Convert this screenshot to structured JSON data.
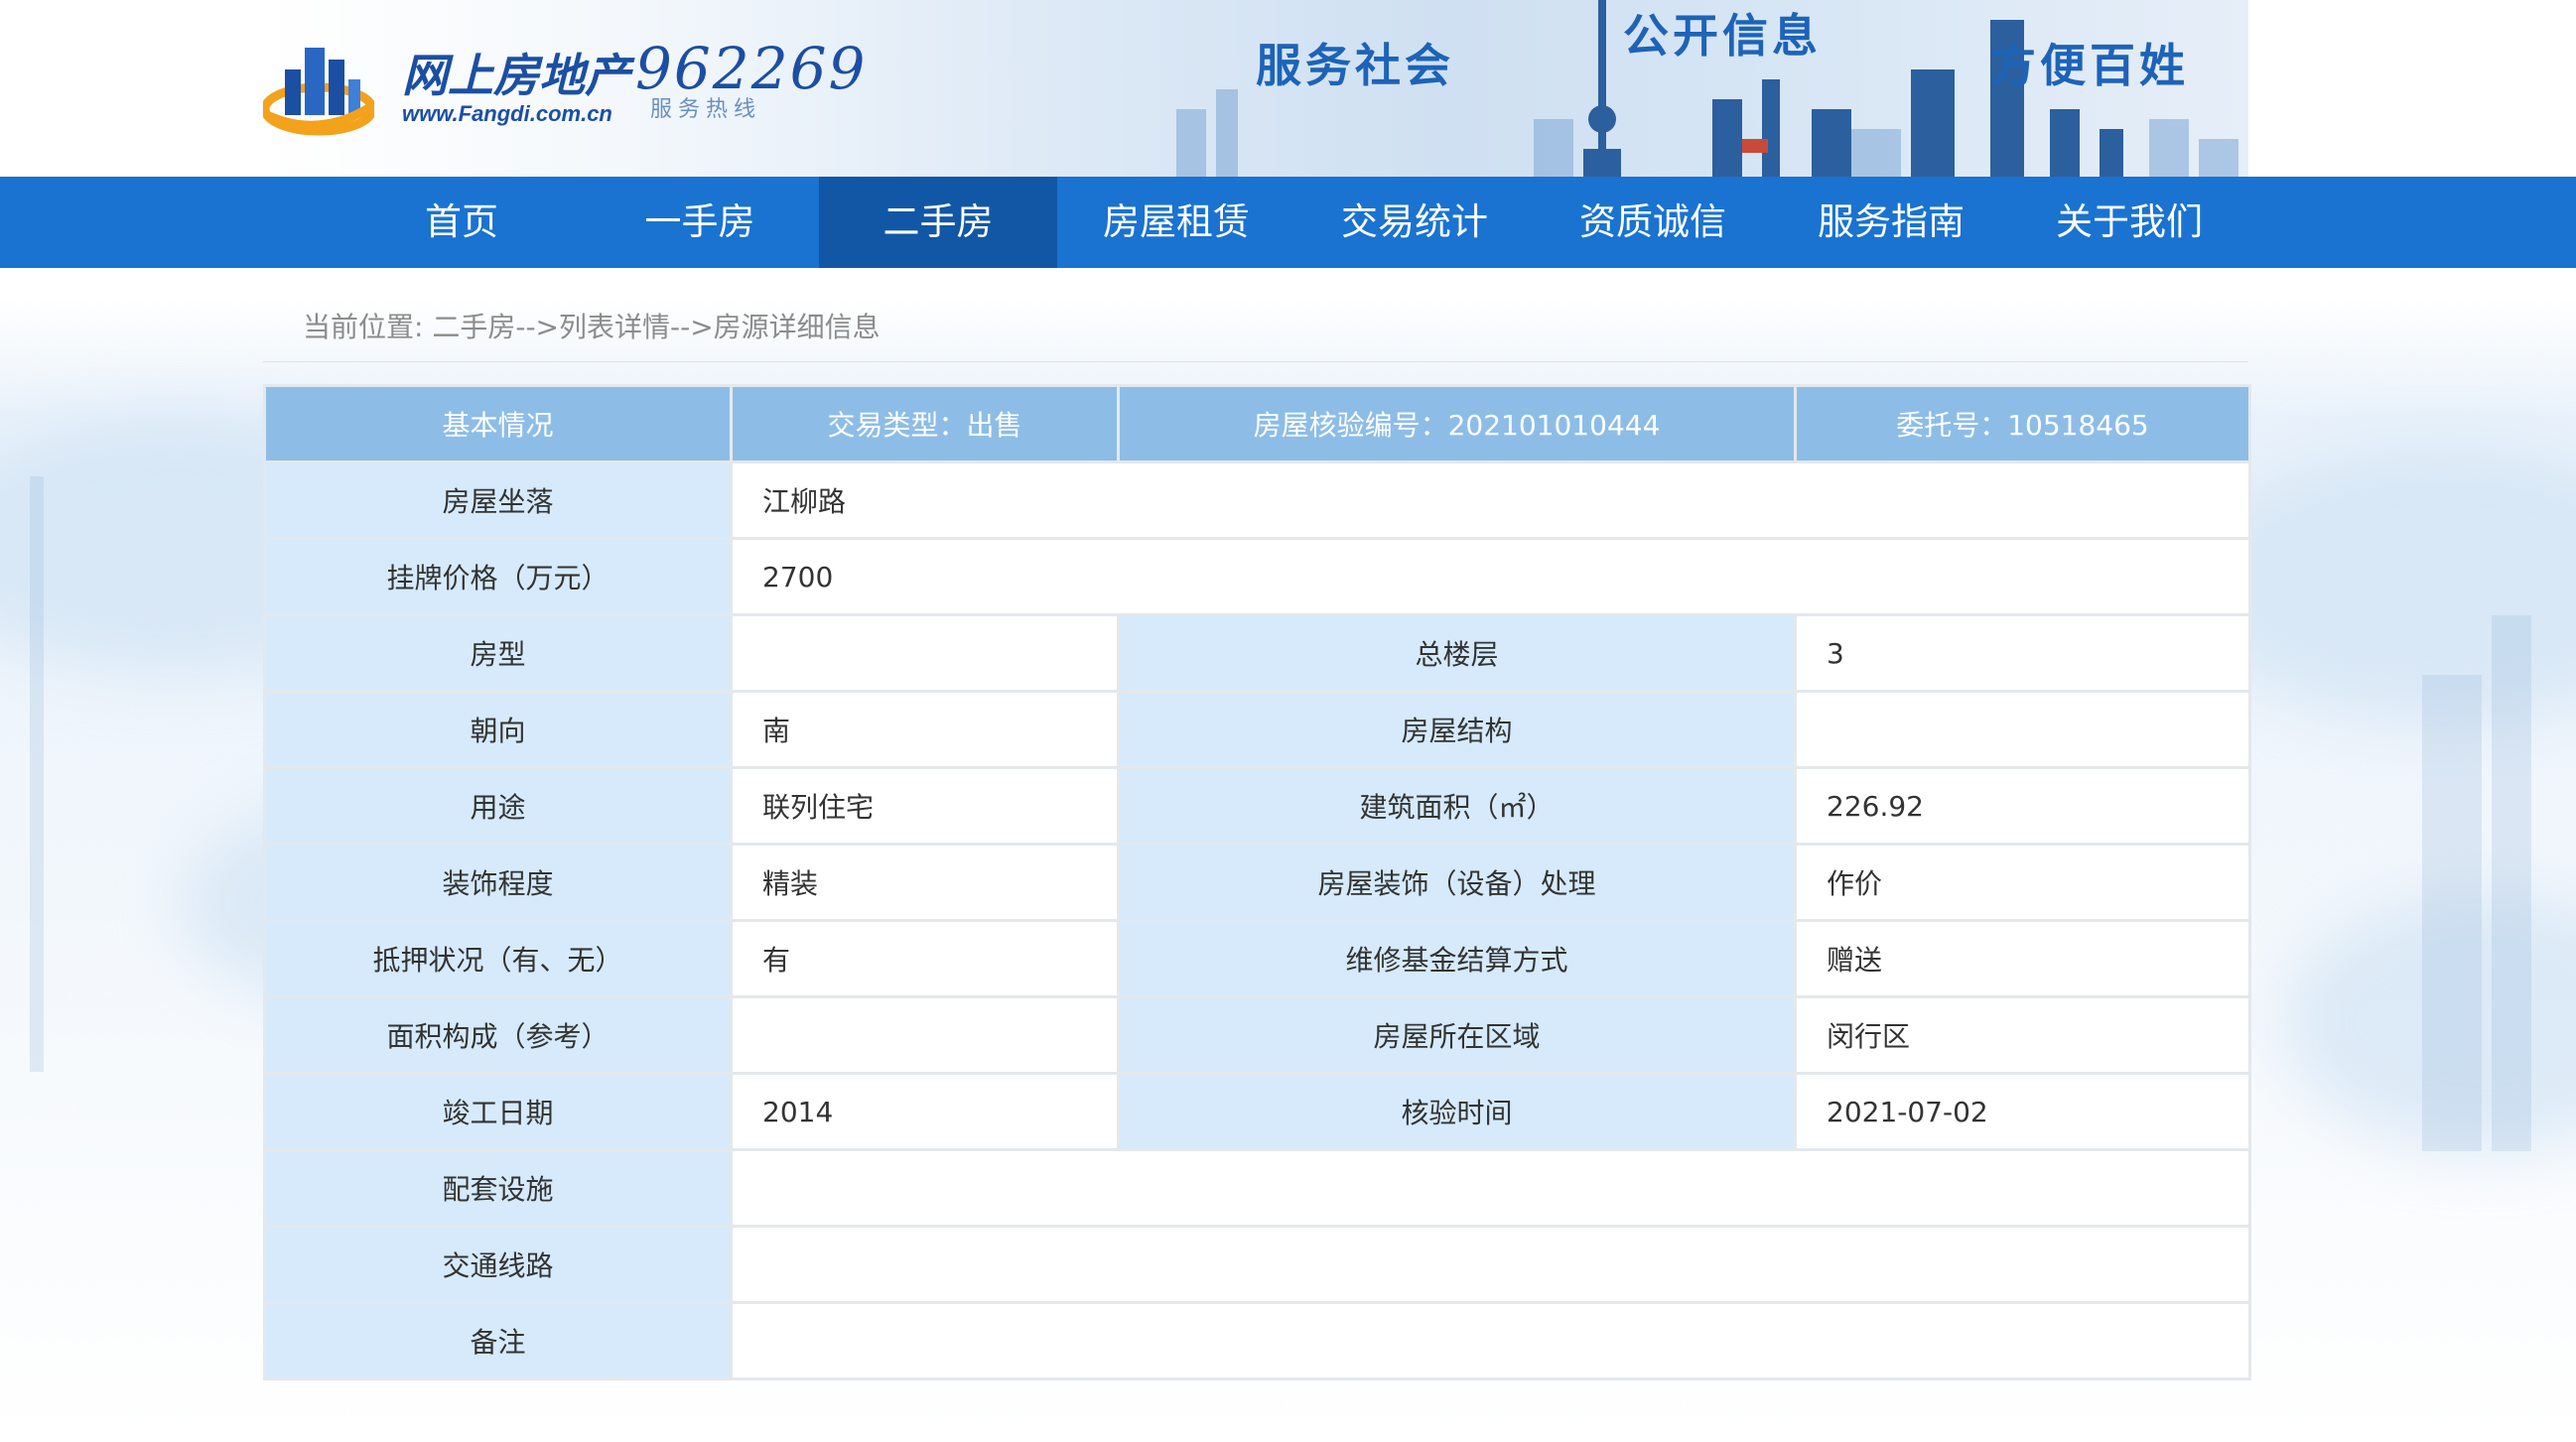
{
  "header": {
    "logo_title": "网上房地产",
    "logo_url": "www.Fangdi.com.cn",
    "hotline": "962269",
    "hotline_sub": "服务热线",
    "slogans": [
      "服务社会",
      "公开信息",
      "方便百姓"
    ]
  },
  "nav": {
    "items": [
      "首页",
      "一手房",
      "二手房",
      "房屋租赁",
      "交易统计",
      "资质诚信",
      "服务指南",
      "关于我们"
    ],
    "active": "二手房"
  },
  "breadcrumb": "当前位置: 二手房-->列表详情-->房源详细信息",
  "table": {
    "header": [
      "基本情况",
      "交易类型：出售",
      "房屋核验编号：202101010444",
      "委托号：10518465"
    ],
    "rows": {
      "location": {
        "label": "房屋坐落",
        "value": "江柳路"
      },
      "price": {
        "label": "挂牌价格（万元）",
        "value": "2700"
      },
      "layout": {
        "label": "房型",
        "value": "",
        "label2": "总楼层",
        "value2": "3"
      },
      "orientation": {
        "label": "朝向",
        "value": "南",
        "label2": "房屋结构",
        "value2": ""
      },
      "usage": {
        "label": "用途",
        "value": "联列住宅",
        "label2": "建筑面积（㎡）",
        "value2": "226.92"
      },
      "decoration": {
        "label": "装饰程度",
        "value": "精装",
        "label2": "房屋装饰（设备）处理",
        "value2": "作价"
      },
      "mortgage": {
        "label": "抵押状况（有、无）",
        "value": "有",
        "label2": "维修基金结算方式",
        "value2": "赠送"
      },
      "area_composition": {
        "label": "面积构成（参考）",
        "value": "",
        "label2": "房屋所在区域",
        "value2": "闵行区"
      },
      "completion": {
        "label": "竣工日期",
        "value": "2014",
        "label2": "核验时间",
        "value2": "2021-07-02"
      },
      "facilities": {
        "label": "配套设施",
        "value": ""
      },
      "transport": {
        "label": "交通线路",
        "value": ""
      },
      "remarks": {
        "label": "备注",
        "value": ""
      }
    }
  },
  "colors": {
    "nav_bg": "#1a73d0",
    "nav_active": "#1257a6",
    "table_header": "#8dbde7",
    "label_cell": "#d6eafb"
  }
}
